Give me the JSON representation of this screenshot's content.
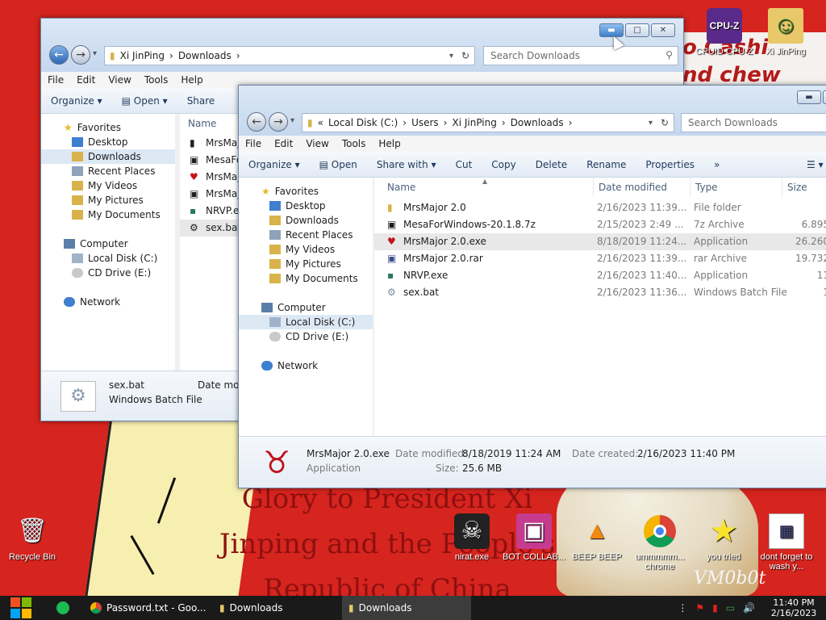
{
  "wallpaper": {
    "caption_lines": [
      "Glory to President Xi",
      "Jinping and the People's",
      "Republic of China"
    ],
    "top_text": "o Cashi\nnd chew",
    "vm_label": "VM0b0t"
  },
  "desktop_icons": [
    {
      "label": "CPUID CPU-Z",
      "icon": "cpu-z-icon"
    },
    {
      "label": "Xi JinPing",
      "icon": "user-folder-icon"
    },
    {
      "label": "Recycle Bin",
      "icon": "recycle-bin-icon"
    },
    {
      "label": "nirat.exe",
      "icon": "skull-icon"
    },
    {
      "label": "BOT COLLAB...",
      "icon": "monitor-icon"
    },
    {
      "label": "BEEP BEEP",
      "icon": "vlc-cone-icon"
    },
    {
      "label": "ummmmm... chrome",
      "icon": "chrome-icon"
    },
    {
      "label": "you tried",
      "icon": "star-icon"
    },
    {
      "label": "dont forget to wash y...",
      "icon": "calendar-file-icon"
    }
  ],
  "window_back": {
    "breadcrumb": [
      "Xi JinPing",
      "Downloads"
    ],
    "search_placeholder": "Search Downloads",
    "menu": [
      "File",
      "Edit",
      "View",
      "Tools",
      "Help"
    ],
    "commands": [
      "Organize",
      "Open",
      "Share"
    ],
    "nav": {
      "favorites_label": "Favorites",
      "favorites": [
        "Desktop",
        "Downloads",
        "Recent Places",
        "My Videos",
        "My Pictures",
        "My Documents"
      ],
      "computer_label": "Computer",
      "drives": [
        "Local Disk (C:)",
        "CD Drive (E:)"
      ],
      "network_label": "Network"
    },
    "column_name": "Name",
    "files": [
      "MrsMaj",
      "MesaFo",
      "MrsMaj",
      "MrsMaj",
      "NRVP.e",
      "sex.bat"
    ],
    "details": {
      "name": "sex.bat",
      "type": "Windows Batch File",
      "date_label": "Date modi"
    }
  },
  "window_front": {
    "breadcrumb": [
      "Local Disk (C:)",
      "Users",
      "Xi JinPing",
      "Downloads"
    ],
    "search_placeholder": "Search Downloads",
    "menu": [
      "File",
      "Edit",
      "View",
      "Tools",
      "Help"
    ],
    "commands": [
      "Organize",
      "Open",
      "Share with",
      "Cut",
      "Copy",
      "Delete",
      "Rename",
      "Properties",
      "»"
    ],
    "nav": {
      "favorites_label": "Favorites",
      "favorites": [
        "Desktop",
        "Downloads",
        "Recent Places",
        "My Videos",
        "My Pictures",
        "My Documents"
      ],
      "computer_label": "Computer",
      "drives": [
        "Local Disk (C:)",
        "CD Drive (E:)"
      ],
      "network_label": "Network"
    },
    "columns": [
      "Name",
      "Date modified",
      "Type",
      "Size"
    ],
    "files": [
      {
        "name": "MrsMajor 2.0",
        "date": "2/16/2023 11:39...",
        "type": "File folder",
        "size": ""
      },
      {
        "name": "MesaForWindows-20.1.8.7z",
        "date": "2/15/2023 2:49 ...",
        "type": "7z Archive",
        "size": "6.895"
      },
      {
        "name": "MrsMajor 2.0.exe",
        "date": "8/18/2019 11:24...",
        "type": "Application",
        "size": "26.260"
      },
      {
        "name": "MrsMajor 2.0.rar",
        "date": "2/16/2023 11:39...",
        "type": "rar Archive",
        "size": "19.732"
      },
      {
        "name": "NRVP.exe",
        "date": "2/16/2023 11:40...",
        "type": "Application",
        "size": "11"
      },
      {
        "name": "sex.bat",
        "date": "2/16/2023 11:36...",
        "type": "Windows Batch File",
        "size": "1"
      }
    ],
    "details": {
      "name": "MrsMajor 2.0.exe",
      "type": "Application",
      "date_modified_label": "Date modified:",
      "date_modified": "8/18/2019 11:24 AM",
      "date_created_label": "Date created:",
      "date_created": "2/16/2023 11:40 PM",
      "size_label": "Size:",
      "size": "25.6 MB"
    }
  },
  "taskbar": {
    "items": [
      "Password.txt - Goo...",
      "Downloads",
      "Downloads"
    ],
    "time": "11:40 PM",
    "date": "2/16/2023"
  },
  "colors": {
    "accent": "#3d7ec8",
    "wallpaper_red": "#d6241e",
    "taskbar": "#1a1a1a"
  }
}
